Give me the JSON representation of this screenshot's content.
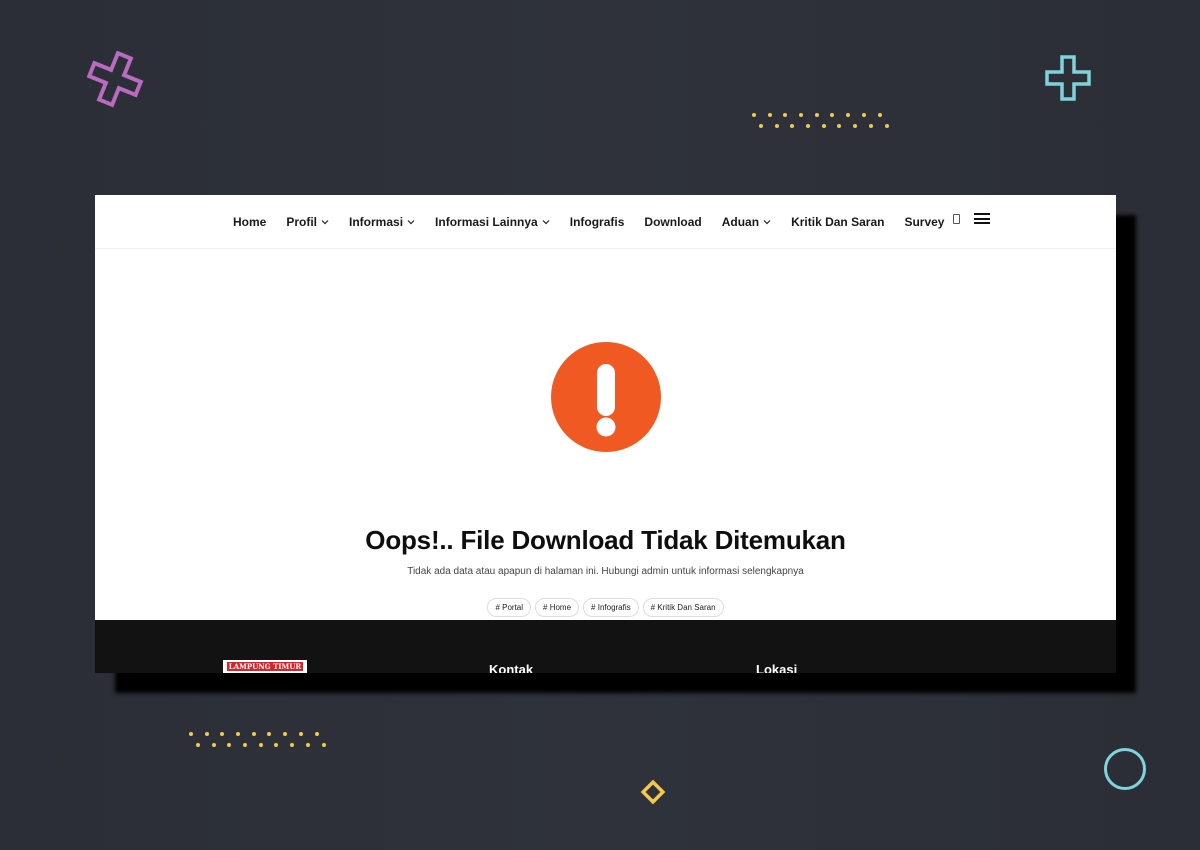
{
  "nav": {
    "items": [
      {
        "label": "Home",
        "has_dropdown": false
      },
      {
        "label": "Profil",
        "has_dropdown": true
      },
      {
        "label": "Informasi",
        "has_dropdown": true
      },
      {
        "label": "Informasi Lainnya",
        "has_dropdown": true
      },
      {
        "label": "Infografis",
        "has_dropdown": false
      },
      {
        "label": "Download",
        "has_dropdown": false
      },
      {
        "label": "Aduan",
        "has_dropdown": true
      },
      {
        "label": "Kritik Dan Saran",
        "has_dropdown": false
      },
      {
        "label": "Survey",
        "has_dropdown": false
      }
    ],
    "search_icon": "search-icon",
    "menu_icon": "hamburger-menu-icon"
  },
  "error": {
    "icon": "exclamation-circle-icon",
    "title": "Oops!.. File Download Tidak Ditemukan",
    "message": "Tidak ada data atau apapun di halaman ini. Hubungi admin untuk informasi selengkapnya",
    "tags": [
      "# Portal",
      "# Home",
      "# Infografis",
      "# Kritik Dan Saran"
    ]
  },
  "footer": {
    "logo_text": "LAMPUNG TIMUR",
    "contact_heading": "Kontak",
    "location_heading": "Lokasi"
  },
  "colors": {
    "background": "#2e3139",
    "accent_orange": "#f05a22",
    "footer_bg": "#121212",
    "deco_pink": "#b86bc0",
    "deco_cyan": "#7fd3dc",
    "deco_yellow": "#f2c94c"
  }
}
